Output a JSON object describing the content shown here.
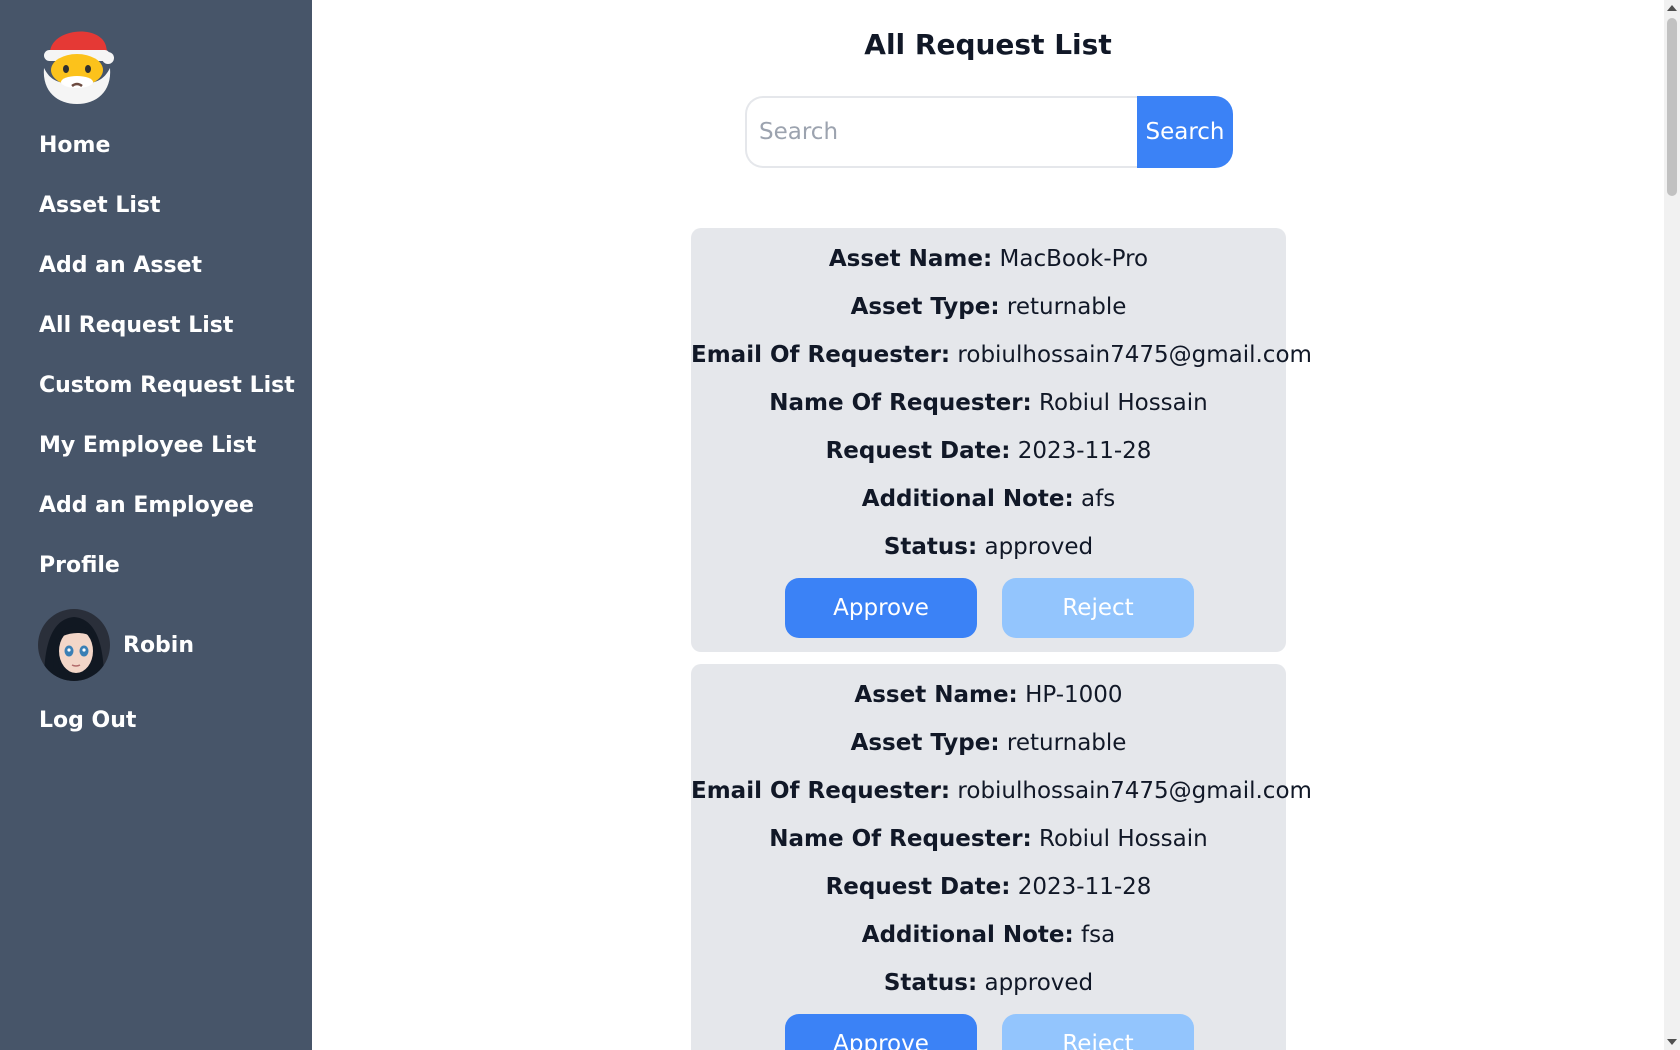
{
  "sidebar": {
    "logo_icon": "santa-claus-icon",
    "items": [
      {
        "label": "Home"
      },
      {
        "label": "Asset List"
      },
      {
        "label": "Add an Asset"
      },
      {
        "label": "All Request List"
      },
      {
        "label": "Custom Request List"
      },
      {
        "label": "My Employee List"
      },
      {
        "label": "Add an Employee"
      },
      {
        "label": "Profile"
      }
    ],
    "user": {
      "name": "Robin"
    },
    "logout_label": "Log Out"
  },
  "main": {
    "title": "All Request List",
    "search": {
      "placeholder": "Search",
      "value": "",
      "button_label": "Search"
    },
    "labels": {
      "asset_name": "Asset Name:",
      "asset_type": "Asset Type:",
      "email": "Email Of Requester:",
      "name": "Name Of Requester:",
      "date": "Request Date:",
      "note": "Additional Note:",
      "status": "Status:"
    },
    "requests": [
      {
        "asset_name": "MacBook-Pro",
        "asset_type": "returnable",
        "email": "robiulhossain7475@gmail.com",
        "name": "Robiul Hossain",
        "date": "2023-11-28",
        "note": "afs",
        "status": "approved",
        "approve_label": "Approve",
        "reject_label": "Reject"
      },
      {
        "asset_name": "HP-1000",
        "asset_type": "returnable",
        "email": "robiulhossain7475@gmail.com",
        "name": "Robiul Hossain",
        "date": "2023-11-28",
        "note": "fsa",
        "status": "approved",
        "approve_label": "Approve",
        "reject_label": "Reject"
      }
    ]
  },
  "colors": {
    "sidebar_bg": "#475569",
    "primary": "#3b82f6",
    "primary_light": "#93c5fd",
    "card_bg": "#e5e7eb"
  }
}
